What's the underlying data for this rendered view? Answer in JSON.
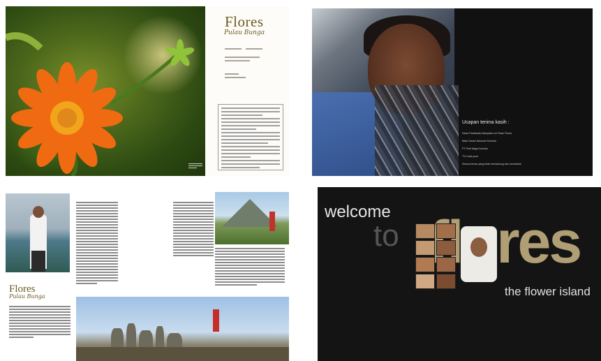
{
  "spread1": {
    "title": "Flores",
    "subtitle": "Pulau Bunga",
    "colors": {
      "title": "#6b5a1f"
    }
  },
  "spread2": {
    "thanks_title": "Ucapan terima kasih :",
    "thanks_items": [
      "Dinas Pariwisata Kabupaten se Pulau Flores",
      "Balai Taman Nasional Komodo",
      "PT Putri Naga Komodo",
      "TVI Loka-pura",
      "Semua teman yang telah mendukung dan membantu"
    ]
  },
  "spread3": {
    "title": "Flores",
    "subtitle": "Pulau Bunga"
  },
  "spread4": {
    "welcome": "welcome",
    "to": "to",
    "flores": "flores",
    "tagline": "the flower island"
  }
}
